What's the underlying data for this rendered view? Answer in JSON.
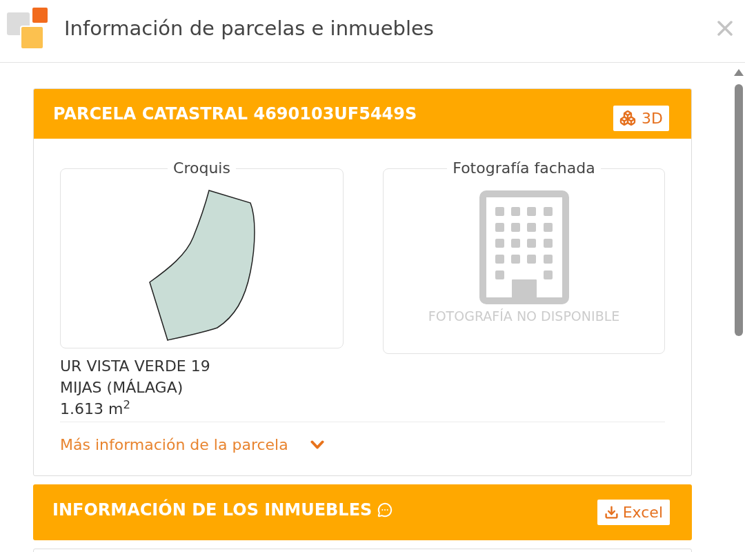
{
  "window": {
    "title": "Información de parcelas e inmuebles"
  },
  "parcel": {
    "title": "PARCELA CATASTRAL 4690103UF5449S",
    "button": "3D",
    "sketch": {
      "legend": "Croquis"
    },
    "photo": {
      "legend": "Fotografía fachada",
      "message": "FOTOGRAFÍA NO DISPONIBLE"
    },
    "address_lines": [
      "UR VISTA VERDE 19",
      "MIJAS (MÁLAGA)",
      "1.613 m$^{2}$"
    ],
    "more_link": {
      "label": "Más información de la parcela",
      "expanded": false
    }
  },
  "properties": {
    "title": "INFORMACIÓN DE LOS INMUEBLES",
    "button": "Excel"
  }
}
